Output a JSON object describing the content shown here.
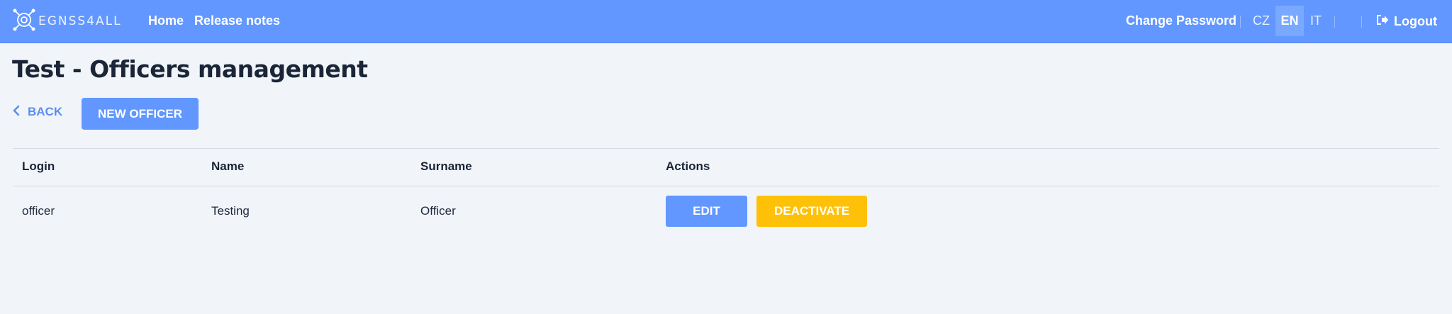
{
  "app": {
    "logo_text": "EGNSS4ALL",
    "logo_icon": "satellite-target-icon"
  },
  "nav": {
    "home": "Home",
    "release_notes": "Release notes",
    "change_password": "Change Password",
    "languages": [
      "CZ",
      "EN",
      "IT"
    ],
    "active_language": "EN",
    "logout": "Logout",
    "logout_icon": "sign-out-icon"
  },
  "page": {
    "title": "Test - Officers management",
    "back_label": "BACK",
    "back_icon": "chevron-left-icon",
    "new_officer_label": "NEW OFFICER"
  },
  "table": {
    "headers": [
      "Login",
      "Name",
      "Surname",
      "Actions"
    ],
    "rows": [
      {
        "login": "officer",
        "name": "Testing",
        "surname": "Officer",
        "actions": [
          "EDIT",
          "DEACTIVATE"
        ]
      }
    ]
  },
  "colors": {
    "primary": "#6197ff",
    "warning": "#ffc107",
    "background": "#f1f5f9"
  }
}
